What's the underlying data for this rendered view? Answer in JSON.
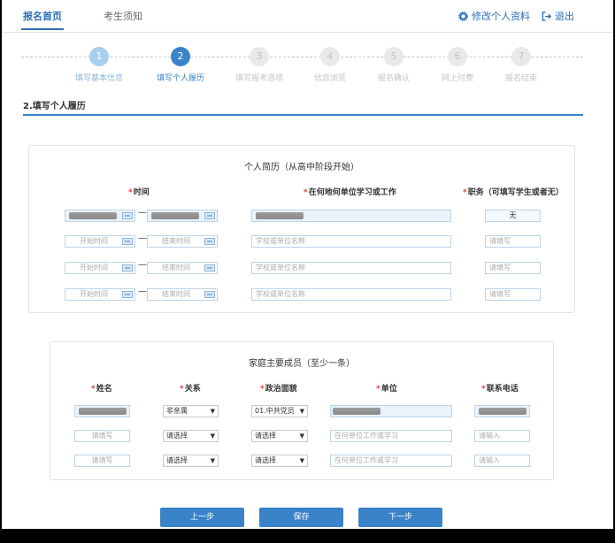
{
  "nav": {
    "tabs": [
      {
        "label": "报名首页"
      },
      {
        "label": "考生须知"
      }
    ],
    "edit_profile": "修改个人资料",
    "logout": "退出"
  },
  "steps": [
    {
      "num": "1",
      "label": "填写基本信息",
      "state": "done"
    },
    {
      "num": "2",
      "label": "填写个人履历",
      "state": "current"
    },
    {
      "num": "3",
      "label": "填写报考选项",
      "state": "todo"
    },
    {
      "num": "4",
      "label": "信息浏览",
      "state": "todo"
    },
    {
      "num": "5",
      "label": "报名确认",
      "state": "todo"
    },
    {
      "num": "6",
      "label": "网上付费",
      "state": "todo"
    },
    {
      "num": "7",
      "label": "报名结束",
      "state": "todo"
    }
  ],
  "section_title": "2.填写个人履历",
  "resume": {
    "title": "个人简历（从高中阶段开始）",
    "headers": {
      "time": "时间",
      "place": "在何地何单位学习或工作",
      "position": "职务（可填写学生或者无）"
    },
    "start_placeholder": "开始时间",
    "end_placeholder": "结束时间",
    "place_placeholder": "学校或单位名称",
    "position_placeholder": "请填写",
    "row1_position": "无",
    "separator": "—"
  },
  "family": {
    "title": "家庭主要成员（至少一条）",
    "headers": {
      "name": "姓名",
      "relation": "关系",
      "political": "政治面貌",
      "unit": "单位",
      "phone": "联系电话"
    },
    "name_placeholder": "请填写",
    "unit_placeholder": "在何单位工作或学习",
    "phone_placeholder": "请输入",
    "select_placeholder": "请选择",
    "row1_relation": "非亲属",
    "row1_political": "01.中共党员"
  },
  "buttons": {
    "prev": "上一步",
    "save": "保存",
    "next": "下一步"
  }
}
